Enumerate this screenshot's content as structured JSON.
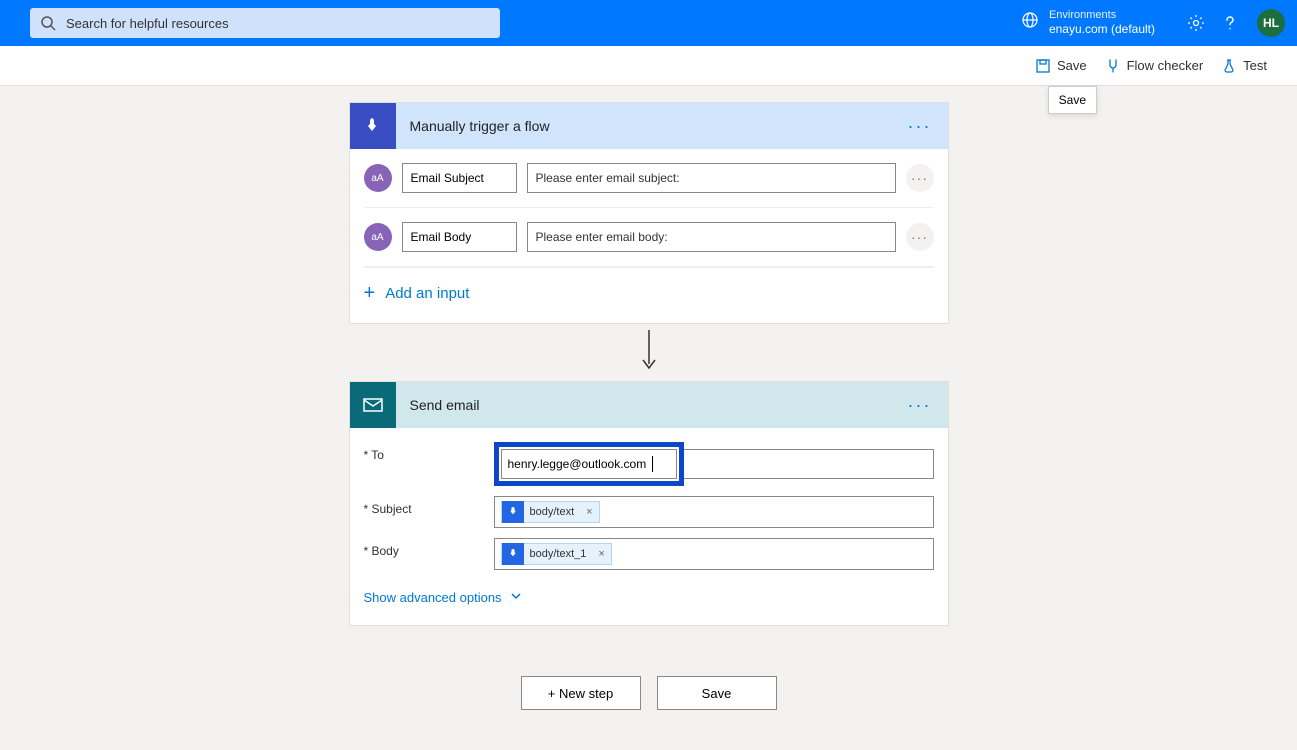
{
  "header": {
    "search_placeholder": "Search for helpful resources",
    "env_label": "Environments",
    "env_name": "enayu.com (default)",
    "avatar_initials": "HL"
  },
  "toolbar": {
    "save": "Save",
    "flow_checker": "Flow checker",
    "test": "Test",
    "tooltip": "Save"
  },
  "trigger": {
    "title": "Manually trigger a flow",
    "inputs": [
      {
        "icon": "aA",
        "name": "Email Subject",
        "desc": "Please enter email subject:"
      },
      {
        "icon": "aA",
        "name": "Email Body",
        "desc": "Please enter email body:"
      }
    ],
    "add_input": "Add an input"
  },
  "action": {
    "title": "Send email",
    "fields": {
      "to_label": "* To",
      "to_value": "henry.legge@outlook.com",
      "subject_label": "* Subject",
      "subject_token": "body/text",
      "body_label": "* Body",
      "body_token": "body/text_1"
    },
    "advanced": "Show advanced options"
  },
  "footer": {
    "new_step": "+ New step",
    "save": "Save"
  }
}
